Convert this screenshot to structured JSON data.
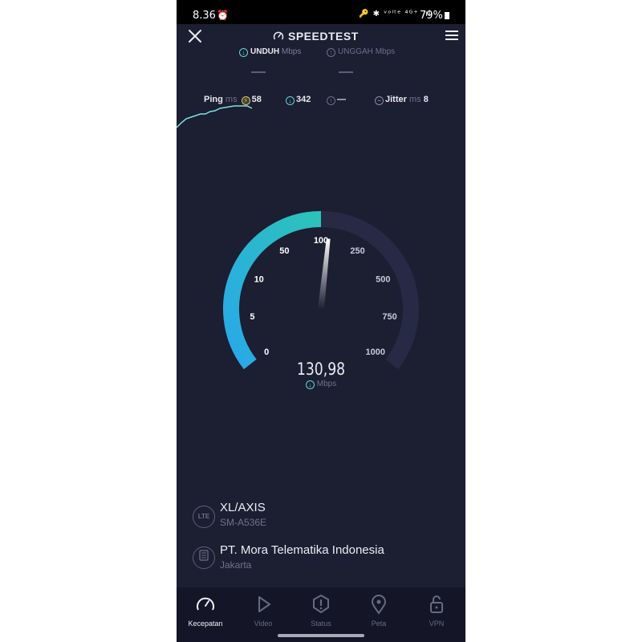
{
  "status_bar": {
    "time": "8.36",
    "icons": "🔑 ✱ ᵛᵒˡᵗᵉ ⁴ᴳ⁺ .ıl",
    "battery": "79%"
  },
  "header": {
    "title": "SPEEDTEST"
  },
  "metrics": {
    "download_label": "UNDUH",
    "download_unit": "Mbps",
    "upload_label": "UNGGAH",
    "upload_unit": "Mbps",
    "download_value": "—",
    "upload_value": "—"
  },
  "ping": {
    "label": "Ping",
    "unit": "ms",
    "idle": "58",
    "download": "342",
    "upload": "—",
    "jitter_label": "Jitter",
    "jitter_unit": "ms",
    "jitter": "8"
  },
  "gauge": {
    "ticks": [
      "0",
      "5",
      "10",
      "50",
      "100",
      "250",
      "500",
      "750",
      "1000"
    ],
    "value": "130,98",
    "unit": "Mbps",
    "progress_fraction": 0.5,
    "colors": {
      "fill_start": "#29a8e9",
      "fill_end": "#2cc3b9",
      "track": "#262a45",
      "needle": "#ffffff"
    }
  },
  "connection": {
    "provider_icon": "LTE",
    "provider": "XL/AXIS",
    "device": "SM-A536E",
    "server": "PT. Mora Telematika Indonesia",
    "city": "Jakarta"
  },
  "nav": {
    "items": [
      {
        "label": "Kecepatan",
        "icon": "speedometer-icon"
      },
      {
        "label": "Video",
        "icon": "play-icon"
      },
      {
        "label": "Status",
        "icon": "alert-icon"
      },
      {
        "label": "Peta",
        "icon": "map-pin-icon"
      },
      {
        "label": "VPN",
        "icon": "lock-icon"
      }
    ]
  }
}
